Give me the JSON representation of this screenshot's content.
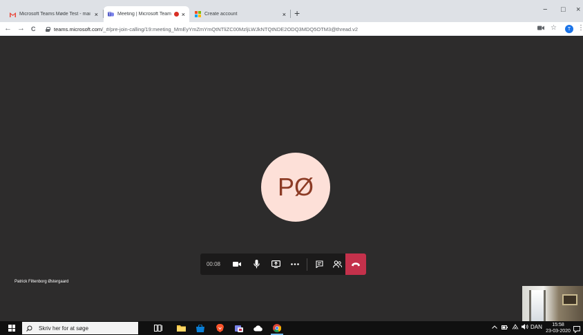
{
  "browser": {
    "tabs": [
      {
        "title": "Microsoft Teams Møde Test - mai",
        "close": "×",
        "favicon": "gmail-icon"
      },
      {
        "title": "Meeting | Microsoft Teams",
        "close": "×",
        "favicon": "teams-icon",
        "recording": true
      },
      {
        "title": "Create account",
        "close": "×",
        "favicon": "microsoft-icon"
      }
    ],
    "new_tab": "+",
    "window_controls": {
      "minimize": "−",
      "maximize": "□",
      "close": "×"
    },
    "url_host": "teams.microsoft.com",
    "url_path": "/_#/pre-join-calling/19:meeting_MmEyYmZmYmQtNTliZC00MzljLWJkNTQtNDE2ODQ3MDQ5OTM3@thread.v2",
    "nav": {
      "back": "←",
      "forward": "→",
      "reload": "C"
    },
    "bookmark_star": "☆",
    "profile_initial": "T",
    "menu": "⋮"
  },
  "meeting": {
    "avatar_initials": "PØ",
    "timer": "00:08",
    "participant_name": "Patrick Filtenborg Østergaard",
    "colors": {
      "stage": "#2d2c2c",
      "avatar_bg": "#fde0d8",
      "avatar_text": "#8c3b25",
      "hangup": "#c4314b"
    }
  },
  "taskbar": {
    "search_placeholder": "Skriv her for at søge",
    "tray_language": "DAN",
    "time": "15:58",
    "date": "23-03-2020"
  }
}
